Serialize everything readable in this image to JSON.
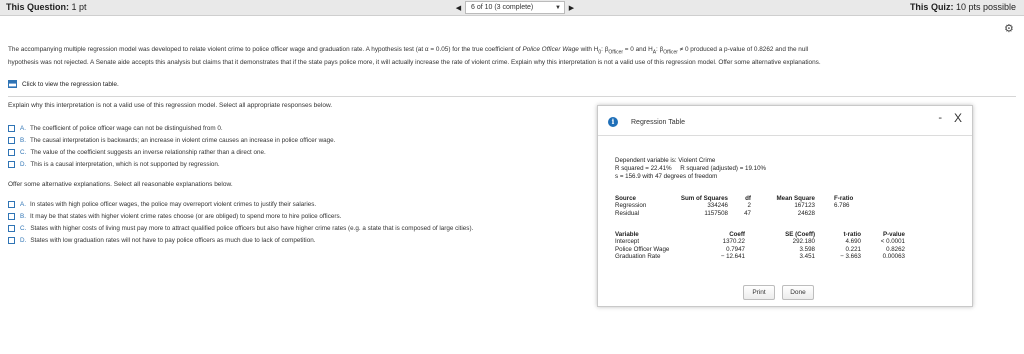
{
  "topbar": {
    "question_label": "This Question:",
    "question_pts": "1 pt",
    "progress": "6 of 10 (3 complete)",
    "quiz_label": "This Quiz:",
    "quiz_pts": "10 pts possible",
    "prev_icon": "triangle-left-icon",
    "next_icon": "triangle-right-icon"
  },
  "gear_icon": "gear-icon",
  "intro": {
    "line1_a": "The accompanying multiple regression model was developed to relate violent crime to police officer wage and graduation rate. A hypothesis test (at α = 0.05) for the true coefficient of ",
    "line1_var": "Police Officer Wage",
    "line1_b": " with H",
    "h0_sub": "0",
    "line1_c": ": β",
    "beta_sub": "Officer",
    "line1_d": " = 0 and H",
    "ha_sub": "A",
    "line1_e": ": β",
    "line1_f": " ≠ 0 produced a p-value of 0.8262 and the null",
    "line2": "hypothesis was not rejected. A Senate aide accepts this analysis but claims that it demonstrates that if the state pays police more, it will actually increase the rate of violent crime. Explain why this interpretation is not a valid use of this regression model. Offer some alternative explanations."
  },
  "view_link": "Click to view the regression table.",
  "explain_prompt": "Explain why this interpretation is not a valid use of this regression model. Select all appropriate responses below.",
  "options1": [
    {
      "letter": "A.",
      "text": "The coefficient of police officer wage can not be distinguished from 0."
    },
    {
      "letter": "B.",
      "text": "The causal interpretation is backwards; an increase in violent crime causes an increase in police officer wage."
    },
    {
      "letter": "C.",
      "text": "The value of the coefficient suggests an inverse relationship rather than a direct one."
    },
    {
      "letter": "D.",
      "text": "This is a causal interpretation, which is not supported by regression."
    }
  ],
  "offer_prompt": "Offer some alternative explanations. Select all reasonable explanations below.",
  "options2": [
    {
      "letter": "A.",
      "text": "In states with high police officer wages, the police may overreport violent crimes to justify their salaries."
    },
    {
      "letter": "B.",
      "text": "It may be that states with higher violent crime rates choose (or are obliged) to spend more to hire police officers."
    },
    {
      "letter": "C.",
      "text": "States with higher costs of living must pay more to attract qualified police officers but also have higher crime rates (e.g. a state that is composed of large cities)."
    },
    {
      "letter": "D.",
      "text": "States with low graduation rates will not have to pay police officers as much due to lack of competition."
    }
  ],
  "modal": {
    "title": "Regression Table",
    "info_icon": "info-icon",
    "minimize": "-",
    "close": "X",
    "dep_var": "Dependent variable is: Violent Crime",
    "r2": "R squared = 22.41%",
    "r2_adj": "R squared (adjusted) = 19.10%",
    "s_line": "s = 156.9 with 47 degrees of freedom",
    "anova": {
      "headers": [
        "Source",
        "Sum of Squares",
        "df",
        "Mean Square",
        "F-ratio"
      ],
      "rows": [
        [
          "Regression",
          "334246",
          "2",
          "167123",
          "6.786"
        ],
        [
          "Residual",
          "1157508",
          "47",
          "24628",
          ""
        ]
      ]
    },
    "coef": {
      "headers": [
        "Variable",
        "Coeff",
        "SE (Coeff)",
        "t-ratio",
        "P-value"
      ],
      "rows": [
        [
          "Intercept",
          "1370.22",
          "292.180",
          "4.690",
          "< 0.0001"
        ],
        [
          "Police Officer Wage",
          "0.7947",
          "3.598",
          "0.221",
          "0.8262"
        ],
        [
          "Graduation Rate",
          "− 12.641",
          "3.451",
          "− 3.663",
          "0.00063"
        ]
      ]
    },
    "print_label": "Print",
    "done_label": "Done"
  }
}
